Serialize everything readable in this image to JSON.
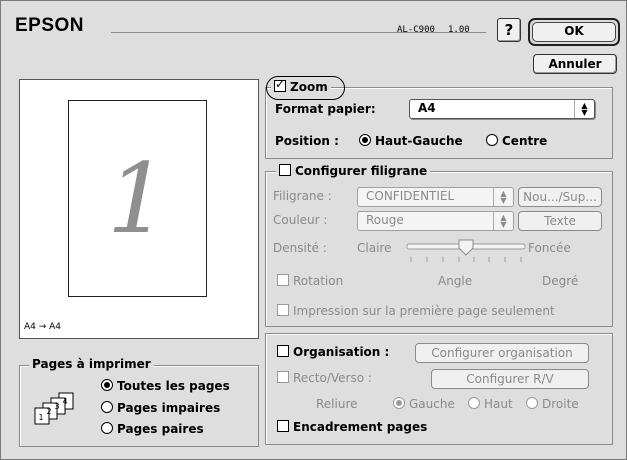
{
  "header": {
    "brand": "EPSON",
    "model": "AL-C900",
    "version": "1.00",
    "help": "?",
    "ok": "OK",
    "cancel": "Annuler"
  },
  "preview": {
    "page_number": "1",
    "caption": "A4 → A4"
  },
  "pages_group": {
    "title": "Pages à imprimer",
    "options": [
      "Toutes les pages",
      "Pages impaires",
      "Pages paires"
    ],
    "selected_index": 0
  },
  "zoom": {
    "label": "Zoom",
    "checked": true,
    "paper_label": "Format papier:",
    "paper_value": "A4",
    "position_label": "Position :",
    "position_options": [
      "Haut-Gauche",
      "Centre"
    ],
    "position_selected": 0
  },
  "watermark": {
    "label": "Configurer filigrane",
    "checked": false,
    "filigrane_label": "Filigrane :",
    "filigrane_value": "CONFIDENTIEL",
    "new_button": "Nou.../Sup...",
    "color_label": "Couleur :",
    "color_value": "Rouge",
    "text_button": "Texte",
    "density_label": "Densité :",
    "density_low": "Claire",
    "density_high": "Foncée",
    "density_level": 0.5,
    "rotation_label": "Rotation",
    "angle_label": "Angle",
    "degree_label": "Degré",
    "first_page_label": "Impression sur la première page seulement"
  },
  "layout": {
    "organisation_label": "Organisation :",
    "organisation_button": "Configurer organisation",
    "duplex_label": "Recto/Verso :",
    "duplex_button": "Configurer R/V",
    "binding_label": "Reliure",
    "binding_options": [
      "Gauche",
      "Haut",
      "Droite"
    ],
    "binding_selected": 0,
    "frame_label": "Encadrement pages"
  }
}
